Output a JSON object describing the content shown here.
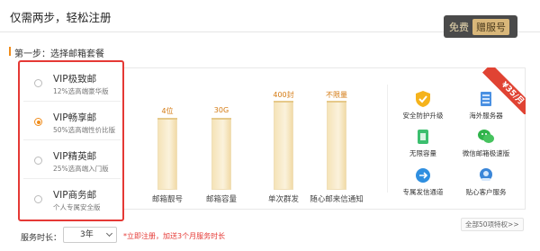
{
  "header": {
    "title": "仅需两步，轻松注册",
    "promo_free": "免费",
    "promo_gift": "赠服号"
  },
  "step": {
    "label": "第一步：选择邮箱套餐"
  },
  "packages": [
    {
      "name": "VIP极致邮",
      "desc": "12%选高端豪华版",
      "selected": false
    },
    {
      "name": "VIP畅享邮",
      "desc": "50%选高端性价比版",
      "selected": true
    },
    {
      "name": "VIP精英邮",
      "desc": "25%选高端入门版",
      "selected": false
    },
    {
      "name": "VIP商务邮",
      "desc": "个人专属安全版",
      "selected": false
    }
  ],
  "ribbon": {
    "price": "¥35/月"
  },
  "chart_data": {
    "type": "bar",
    "categories": [
      "邮箱靓号",
      "邮箱容量",
      "单次群发",
      "随心邮来信通知"
    ],
    "value_labels": [
      "4位",
      "30G",
      "400封",
      "不限量"
    ],
    "values": [
      4,
      30,
      400,
      null
    ]
  },
  "features": [
    {
      "label": "安全防护升级",
      "icon": "shield-icon"
    },
    {
      "label": "海外服务器",
      "icon": "server-icon"
    },
    {
      "label": "无限容量",
      "icon": "storage-icon"
    },
    {
      "label": "微信邮箱极速版",
      "icon": "wechat-icon"
    },
    {
      "label": "专属发信通道",
      "icon": "send-channel-icon"
    },
    {
      "label": "贴心客户服务",
      "icon": "customer-service-icon"
    }
  ],
  "more_link": "全部50项特权>>",
  "duration": {
    "label": "服务时长：",
    "value": "3年",
    "note": "*立即注册，加送3个月服务时长"
  },
  "colors": {
    "accent": "#f08c1c",
    "highlight_border": "#e53935",
    "bar": "#f7e6bf",
    "ribbon": "#e04333"
  }
}
